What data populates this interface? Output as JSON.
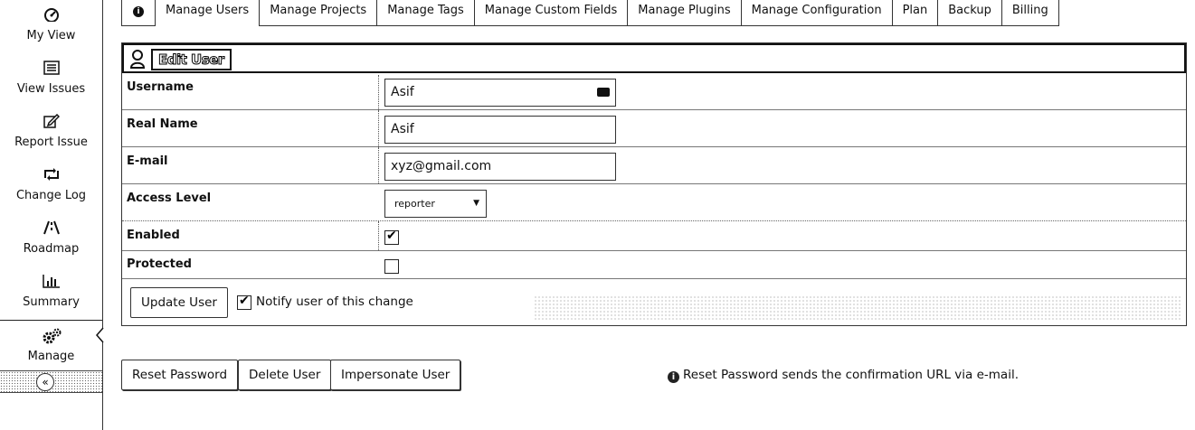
{
  "sidebar": {
    "items": [
      {
        "label": "My View",
        "icon": "dashboard-icon"
      },
      {
        "label": "View Issues",
        "icon": "list-icon"
      },
      {
        "label": "Report Issue",
        "icon": "edit-icon"
      },
      {
        "label": "Change Log",
        "icon": "retweet-icon"
      },
      {
        "label": "Roadmap",
        "icon": "road-icon"
      },
      {
        "label": "Summary",
        "icon": "bar-chart-icon"
      },
      {
        "label": "Manage",
        "icon": "gears-icon"
      }
    ],
    "collapse_glyph": "«"
  },
  "tabs": {
    "info_glyph": "i",
    "items": [
      "Manage Users",
      "Manage Projects",
      "Manage Tags",
      "Manage Custom Fields",
      "Manage Plugins",
      "Manage Configuration",
      "Plan",
      "Backup",
      "Billing"
    ],
    "selected": "Manage Users"
  },
  "form": {
    "title": "Edit User",
    "fields": {
      "username": {
        "label": "Username",
        "value": "Asif"
      },
      "realname": {
        "label": "Real Name",
        "value": "Asif"
      },
      "email": {
        "label": "E-mail",
        "value": "xyz@gmail.com"
      },
      "access_level": {
        "label": "Access Level",
        "value": "reporter"
      },
      "enabled": {
        "label": "Enabled",
        "checked": true
      },
      "protected": {
        "label": "Protected",
        "checked": false
      }
    },
    "update_button": "Update User",
    "notify_label": "Notify user of this change",
    "notify_checked": true
  },
  "actions": {
    "reset_password": "Reset Password",
    "delete_user": "Delete User",
    "impersonate_user": "Impersonate User"
  },
  "info_message": "Reset Password sends the confirmation URL via e-mail."
}
